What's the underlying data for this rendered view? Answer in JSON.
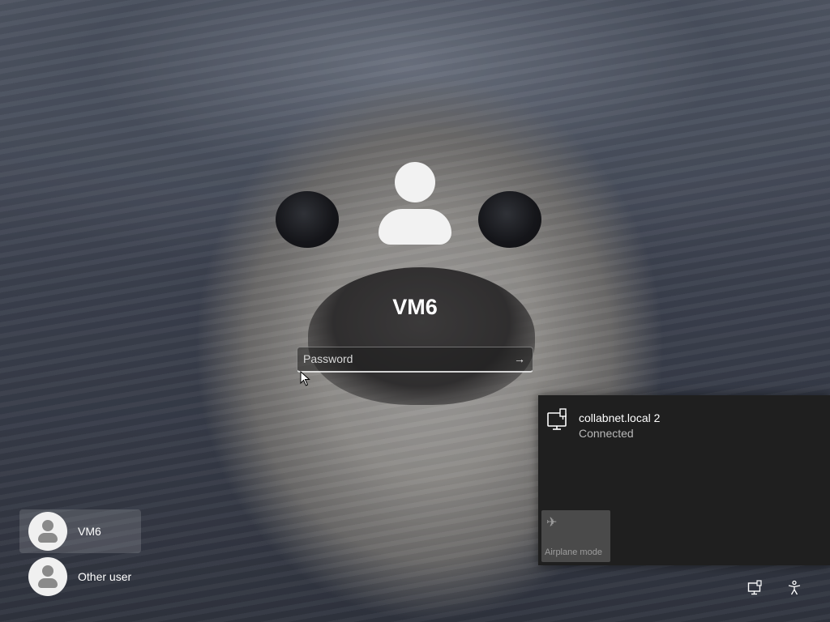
{
  "login": {
    "user_name": "VM6",
    "password_placeholder": "Password",
    "submit_icon": "arrow-right-icon"
  },
  "user_list": [
    {
      "name": "VM6",
      "selected": true
    },
    {
      "name": "Other user",
      "selected": false
    }
  ],
  "network_flyout": {
    "network_name": "collabnet.local 2",
    "network_status": "Connected",
    "network_icon": "ethernet-monitor-icon",
    "airplane_mode_label": "Airplane mode",
    "airplane_mode_icon": "airplane-icon"
  },
  "taskbar_icons": {
    "network": "network-icon",
    "accessibility": "accessibility-icon"
  },
  "colors": {
    "flyout_bg": "#1f1f1f",
    "airplane_tile_bg": "#4a4a4a",
    "text_primary": "#ffffff"
  }
}
